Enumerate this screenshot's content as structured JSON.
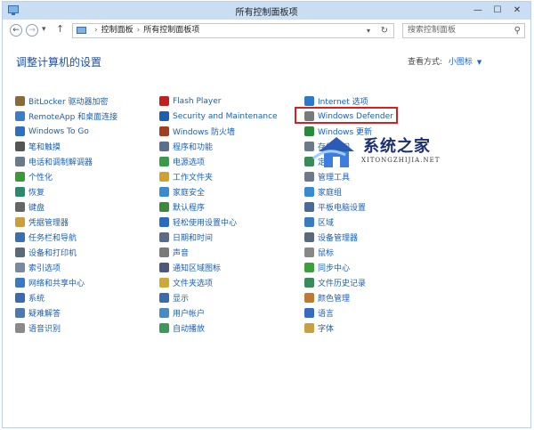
{
  "window": {
    "title": "所有控制面板项"
  },
  "address": {
    "breadcrumb": [
      "控制面板",
      "所有控制面板项"
    ],
    "search_placeholder": "搜索控制面板"
  },
  "main": {
    "heading": "调整计算机的设置",
    "view_by_label": "查看方式:",
    "view_by_value": "小图标"
  },
  "columns": [
    [
      {
        "label": "BitLocker 驱动器加密",
        "color": "#8a6a3a"
      },
      {
        "label": "RemoteApp 和桌面连接",
        "color": "#3b7dc9"
      },
      {
        "label": "Windows To Go",
        "color": "#2f6fbf"
      },
      {
        "label": "笔和触摸",
        "color": "#555555"
      },
      {
        "label": "电话和调制解调器",
        "color": "#6a7a8a"
      },
      {
        "label": "个性化",
        "color": "#3a9a3a"
      },
      {
        "label": "恢复",
        "color": "#2a8a6a"
      },
      {
        "label": "键盘",
        "color": "#666666"
      },
      {
        "label": "凭据管理器",
        "color": "#c8a040"
      },
      {
        "label": "任务栏和导航",
        "color": "#3a6fb0"
      },
      {
        "label": "设备和打印机",
        "color": "#5a6a7a"
      },
      {
        "label": "索引选项",
        "color": "#7a8aa0"
      },
      {
        "label": "网络和共享中心",
        "color": "#3a7ac0"
      },
      {
        "label": "系统",
        "color": "#3a6ab0"
      },
      {
        "label": "疑难解答",
        "color": "#4a7ab0"
      },
      {
        "label": "语音识别",
        "color": "#8a8a8a"
      }
    ],
    [
      {
        "label": "Flash Player",
        "color": "#c02020"
      },
      {
        "label": "Security and Maintenance",
        "color": "#1a5fb4"
      },
      {
        "label": "Windows 防火墙",
        "color": "#a04020"
      },
      {
        "label": "程序和功能",
        "color": "#5a7090"
      },
      {
        "label": "电源选项",
        "color": "#3a9a4a"
      },
      {
        "label": "工作文件夹",
        "color": "#d0a030"
      },
      {
        "label": "家庭安全",
        "color": "#3a8ad0"
      },
      {
        "label": "默认程序",
        "color": "#3a8a3a"
      },
      {
        "label": "轻松使用设置中心",
        "color": "#2a6ac0"
      },
      {
        "label": "日期和时间",
        "color": "#5a6a8a"
      },
      {
        "label": "声音",
        "color": "#7a7a7a"
      },
      {
        "label": "通知区域图标",
        "color": "#4a5a7a"
      },
      {
        "label": "文件夹选项",
        "color": "#d0a838"
      },
      {
        "label": "显示",
        "color": "#3a6ab0"
      },
      {
        "label": "用户帐户",
        "color": "#4a8ac0"
      },
      {
        "label": "自动播放",
        "color": "#3a9a5a"
      }
    ],
    [
      {
        "label": "Internet 选项",
        "color": "#2a7ac8"
      },
      {
        "label": "Windows Defender",
        "color": "#7a7a7a"
      },
      {
        "label": "Windows 更新",
        "color": "#2a8a3a"
      },
      {
        "label": "存储空间",
        "color": "#6a7a8a"
      },
      {
        "label": "定位设置",
        "color": "#3a8a5a"
      },
      {
        "label": "管理工具",
        "color": "#6a7a8a"
      },
      {
        "label": "家庭组",
        "color": "#3a8ad0"
      },
      {
        "label": "平板电脑设置",
        "color": "#4a6a9a"
      },
      {
        "label": "区域",
        "color": "#3a7ac0"
      },
      {
        "label": "设备管理器",
        "color": "#5a6a7a"
      },
      {
        "label": "鼠标",
        "color": "#888888"
      },
      {
        "label": "同步中心",
        "color": "#3aa03a"
      },
      {
        "label": "文件历史记录",
        "color": "#3a8a5a"
      },
      {
        "label": "颜色管理",
        "color": "#c07a30"
      },
      {
        "label": "语言",
        "color": "#3a6ac0"
      },
      {
        "label": "字体",
        "color": "#c8a040"
      }
    ]
  ],
  "watermark": {
    "title": "系统之家",
    "subtitle": "XITONGZHIJIA.NET"
  }
}
